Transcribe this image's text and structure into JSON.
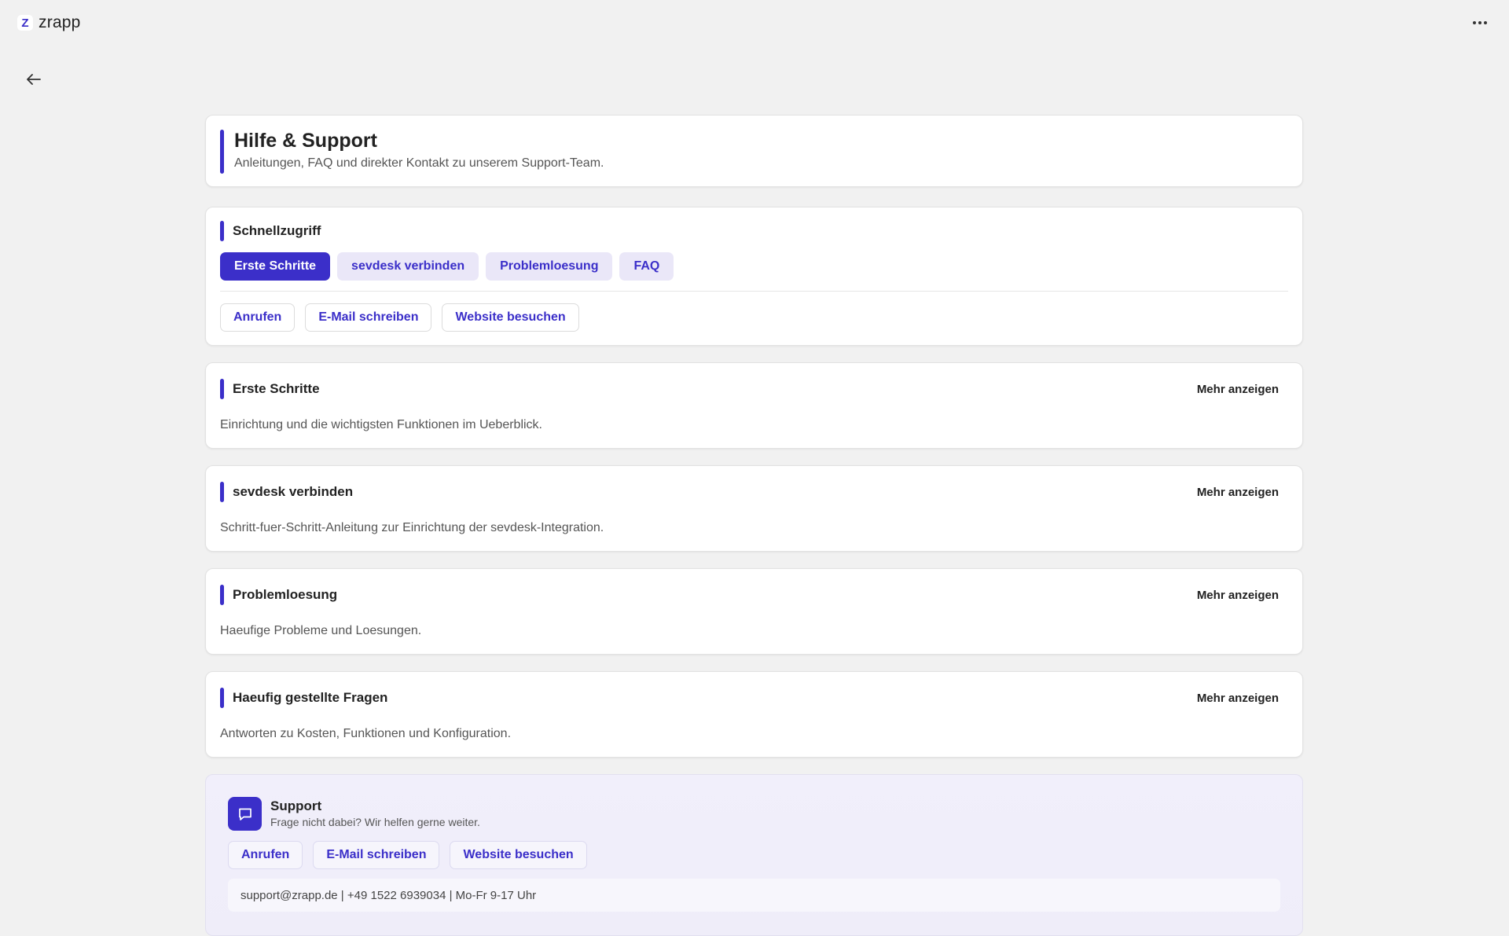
{
  "app": {
    "name": "zrapp",
    "logo_glyph": "Z",
    "accent_color": "#3b2fc9"
  },
  "header": {
    "title": "Hilfe & Support",
    "subtitle": "Anleitungen, FAQ und direkter Kontakt zu unserem Support-Team."
  },
  "quick_access": {
    "title": "Schnellzugriff",
    "chips": [
      {
        "label": "Erste Schritte",
        "active": true
      },
      {
        "label": "sevdesk verbinden",
        "active": false
      },
      {
        "label": "Problemloesung",
        "active": false
      },
      {
        "label": "FAQ",
        "active": false
      }
    ],
    "links": [
      "Anrufen",
      "E-Mail schreiben",
      "Website besuchen"
    ]
  },
  "topics": [
    {
      "title": "Erste Schritte",
      "description": "Einrichtung und die wichtigsten Funktionen im Ueberblick.",
      "more_label": "Mehr anzeigen"
    },
    {
      "title": "sevdesk verbinden",
      "description": "Schritt-fuer-Schritt-Anleitung zur Einrichtung der sevdesk-Integration.",
      "more_label": "Mehr anzeigen"
    },
    {
      "title": "Problemloesung",
      "description": "Haeufige Probleme und Loesungen.",
      "more_label": "Mehr anzeigen"
    },
    {
      "title": "Haeufig gestellte Fragen",
      "description": "Antworten zu Kosten, Funktionen und Konfiguration.",
      "more_label": "Mehr anzeigen"
    }
  ],
  "support": {
    "icon": "chat-bubble-icon",
    "title": "Support",
    "subtitle": "Frage nicht dabei? Wir helfen gerne weiter.",
    "links": [
      "Anrufen",
      "E-Mail schreiben",
      "Website besuchen"
    ],
    "contact": "support@zrapp.de | +49 1522 6939034 | Mo-Fr 9-17 Uhr"
  }
}
